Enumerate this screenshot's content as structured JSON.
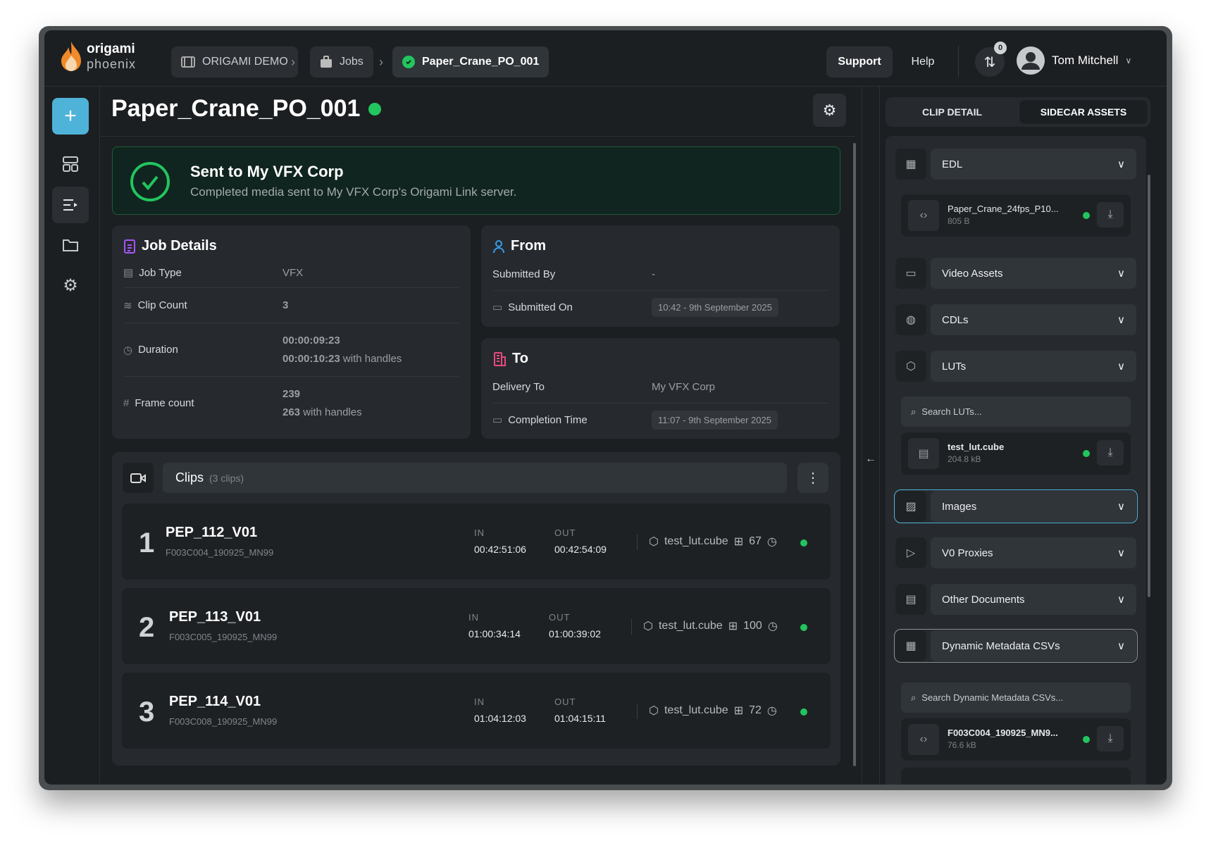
{
  "brand": {
    "name": "origami",
    "sub": "phoenix"
  },
  "breadcrumbs": [
    {
      "label": "ORIGAMI DEMO",
      "icon": "film-icon"
    },
    {
      "label": "Jobs",
      "icon": "briefcase-icon"
    },
    {
      "label": "Paper_Crane_PO_001",
      "icon": "check-circle-icon"
    }
  ],
  "header": {
    "support": "Support",
    "help": "Help",
    "transfers_badge": "0",
    "user": "Tom Mitchell"
  },
  "page": {
    "title": "Paper_Crane_PO_001"
  },
  "banner": {
    "title": "Sent to My VFX Corp",
    "message": "Completed media sent to My VFX Corp's Origami Link server."
  },
  "job_details": {
    "title": "Job Details",
    "rows": [
      {
        "label": "Job Type",
        "value": "VFX"
      },
      {
        "label": "Clip Count",
        "value": "3"
      },
      {
        "label": "Duration",
        "value": "00:00:09:23",
        "value2": "00:00:10:23",
        "suffix": "with handles"
      },
      {
        "label": "Frame count",
        "value": "239",
        "value2": "263",
        "suffix": "with handles"
      }
    ]
  },
  "from": {
    "title": "From",
    "submitted_by_label": "Submitted By",
    "submitted_by": "-",
    "submitted_on_label": "Submitted On",
    "submitted_on": "10:42 - 9th September 2025"
  },
  "to": {
    "title": "To",
    "delivery_label": "Delivery To",
    "delivery": "My VFX Corp",
    "completion_label": "Completion Time",
    "completion": "11:07 - 9th September 2025"
  },
  "clips": {
    "title": "Clips",
    "count": "(3 clips)",
    "in_label": "IN",
    "out_label": "OUT",
    "items": [
      {
        "num": "1",
        "name": "PEP_112_V01",
        "source": "F003C004_190925_MN99",
        "in": "00:42:51:06",
        "out": "00:42:54:09",
        "lut": "test_lut.cube",
        "frames": "67"
      },
      {
        "num": "2",
        "name": "PEP_113_V01",
        "source": "F003C005_190925_MN99",
        "in": "01:00:34:14",
        "out": "01:00:39:02",
        "lut": "test_lut.cube",
        "frames": "100"
      },
      {
        "num": "3",
        "name": "PEP_114_V01",
        "source": "F003C008_190925_MN99",
        "in": "01:04:12:03",
        "out": "01:04:15:11",
        "lut": "test_lut.cube",
        "frames": "72"
      }
    ]
  },
  "right": {
    "tabs": [
      "CLIP DETAIL",
      "SIDECAR ASSETS"
    ],
    "active_tab": "SIDECAR ASSETS",
    "sections": [
      "EDL",
      "Video Assets",
      "CDLs",
      "LUTs",
      "Images",
      "V0 Proxies",
      "Other Documents",
      "Dynamic Metadata CSVs"
    ],
    "edl_file": {
      "name": "Paper_Crane_24fps_P10...",
      "size": "805 B"
    },
    "lut_search": "Search LUTs...",
    "lut_file": {
      "name": "test_lut.cube",
      "size": "204.8 kB"
    },
    "csv_search": "Search Dynamic Metadata CSVs...",
    "csv_file": {
      "name": "F003C004_190925_MN9...",
      "size": "76.6 kB"
    }
  },
  "colors": {
    "accent": "#4fb3d9",
    "success": "#22c55e",
    "job_icon": "#a855f7",
    "from_icon": "#3b9be8",
    "to_icon": "#e84a7f"
  }
}
